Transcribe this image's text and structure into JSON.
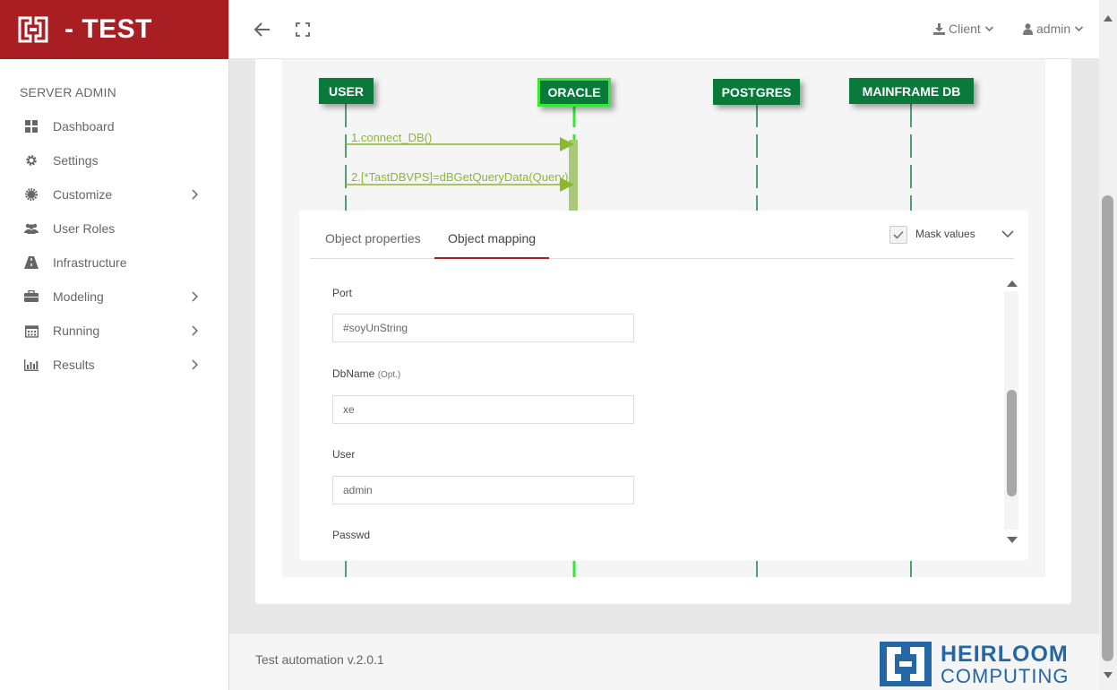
{
  "brand": {
    "title": "- TEST",
    "color": "#a81e22"
  },
  "sidebar": {
    "section": "SERVER ADMIN",
    "items": [
      {
        "label": "Dashboard",
        "icon": "dashboard-icon",
        "has_submenu": false
      },
      {
        "label": "Settings",
        "icon": "gear-icon",
        "has_submenu": false
      },
      {
        "label": "Customize",
        "icon": "cog-icon",
        "has_submenu": true
      },
      {
        "label": "User Roles",
        "icon": "users-icon",
        "has_submenu": false
      },
      {
        "label": "Infrastructure",
        "icon": "road-icon",
        "has_submenu": false
      },
      {
        "label": "Modeling",
        "icon": "briefcase-icon",
        "has_submenu": true
      },
      {
        "label": "Running",
        "icon": "calendar-icon",
        "has_submenu": true
      },
      {
        "label": "Results",
        "icon": "bar-chart-icon",
        "has_submenu": true
      }
    ]
  },
  "header": {
    "client_label": "Client",
    "admin_label": "admin"
  },
  "diagram": {
    "lifelines": [
      "USER",
      "ORACLE",
      "POSTGRES",
      "MAINFRAME DB"
    ],
    "active_lifeline": "ORACLE",
    "messages": [
      "1.connect_DB()",
      "2.[*TastDBVPS]=dBGetQueryData(Query)"
    ],
    "lifeline_color": "#0a7a3b",
    "message_color": "#8ab82e",
    "active_color": "#39e639"
  },
  "properties": {
    "tabs": [
      "Object properties",
      "Object mapping"
    ],
    "active_tab": "Object mapping",
    "mask_values_label": "Mask values",
    "mask_values_checked": true,
    "fields": [
      {
        "label": "Port",
        "optional": "",
        "value": "#soyUnString"
      },
      {
        "label": "DbName",
        "optional": "(Opt.)",
        "value": "xe"
      },
      {
        "label": "User",
        "optional": "",
        "value": "admin"
      },
      {
        "label": "Passwd",
        "optional": ""
      }
    ]
  },
  "footer": {
    "version": "Test automation v.2.0.1",
    "logo_line1": "HEIRLOOM",
    "logo_line2": "COMPUTING",
    "logo_color": "#2367a5"
  }
}
